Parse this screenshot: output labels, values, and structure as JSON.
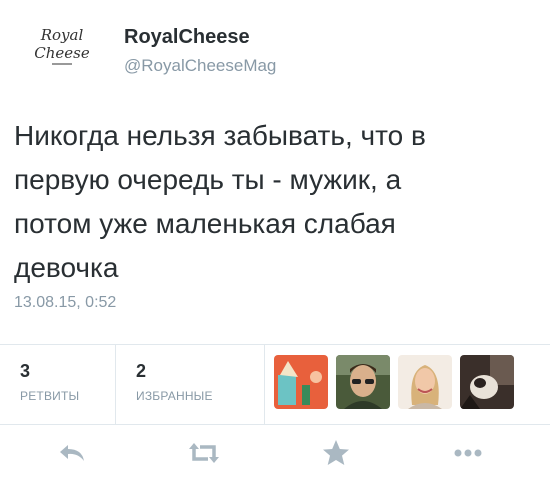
{
  "account": {
    "name": "RoyalCheese",
    "handle": "@RoyalCheeseMag",
    "logo_lines": [
      "Royal",
      "Cheese"
    ],
    "logo_icon": "royal-cheese-logo"
  },
  "tweet": {
    "lines": [
      "Никогда нельзя забывать, что в",
      "первую очередь ты - мужик, а",
      "потом уже маленькая слабая",
      "девочка"
    ],
    "timestamp": "13.08.15, 0:52"
  },
  "stats": {
    "retweets": {
      "count": "3",
      "label": "РЕТВИТЫ"
    },
    "favorites": {
      "count": "2",
      "label": "ИЗБРАННЫЕ"
    }
  },
  "avatars": [
    {
      "icon": "user-avatar",
      "color": "#e8603c"
    },
    {
      "icon": "user-avatar",
      "color": "#4a5a3a"
    },
    {
      "icon": "user-avatar",
      "color": "#e7d6c4"
    },
    {
      "icon": "user-avatar",
      "color": "#3a2f2a"
    }
  ],
  "actions": [
    {
      "icon": "reply-icon"
    },
    {
      "icon": "retweet-icon"
    },
    {
      "icon": "favorite-star-icon"
    },
    {
      "icon": "more-dots-icon"
    }
  ],
  "colors": {
    "text": "#292f33",
    "secondary": "#8899a6",
    "divider": "#e1e8ed",
    "action_icon": "#aab8c2"
  }
}
